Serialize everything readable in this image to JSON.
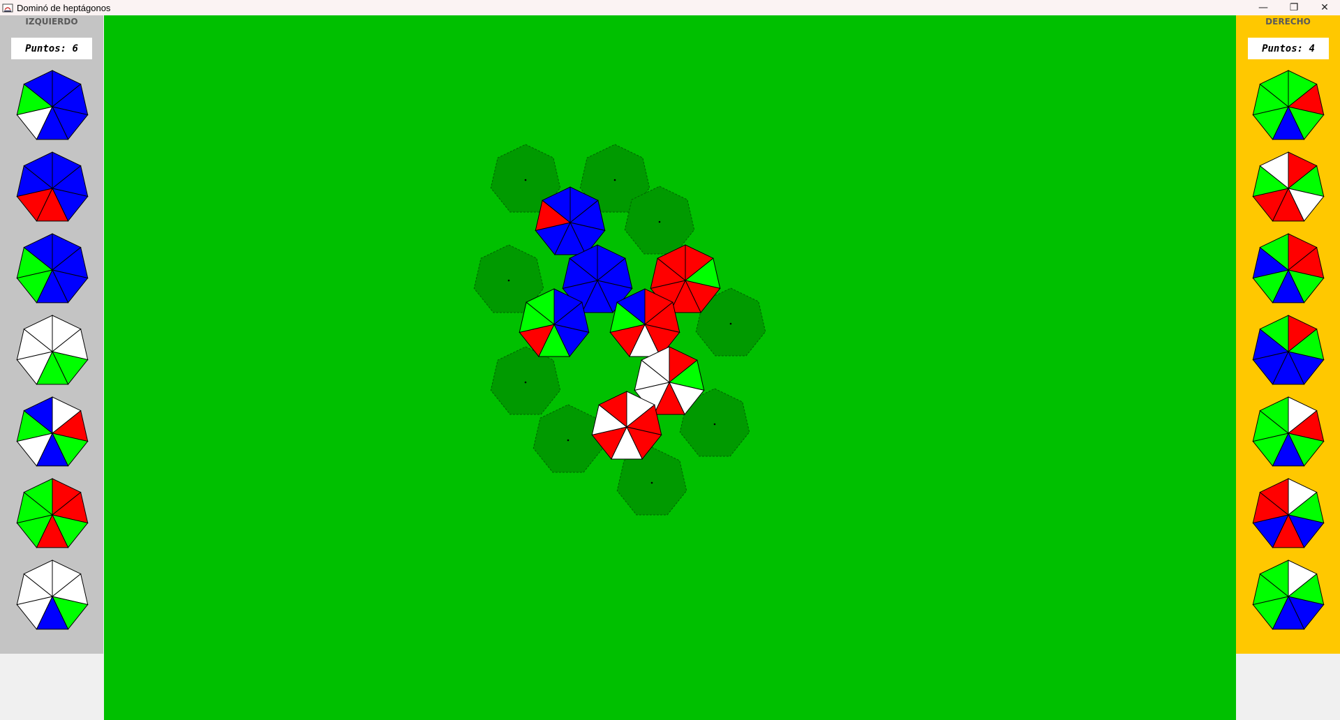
{
  "window": {
    "title": "Dominó de heptágonos",
    "icon": "java-cup-icon",
    "controls": [
      "minimize-icon",
      "restore-icon",
      "close-icon"
    ]
  },
  "colors": {
    "board": "#00c000",
    "slot": "#009a00",
    "left_panel": "#c4c4c4",
    "right_panel": "#ffc800",
    "B": "#0000ff",
    "R": "#ff0000",
    "G": "#00ff00",
    "W": "#ffffff"
  },
  "players": {
    "left": {
      "name": "IZQUIERDO",
      "score_label": "Puntos: 6",
      "pieces": [
        "BBBBWGB",
        "BBBRRBB",
        "BBBBGGB",
        "WWGGWWW",
        "WRGBWGB",
        "RRGRGGG",
        "WWGBWWW"
      ]
    },
    "right": {
      "name": "DERECHO",
      "score_label": "Puntos: 4",
      "pieces": [
        "GRGBGGG",
        "RGWRRGW",
        "RRGBGBG",
        "RGBBBBG",
        "WRGBGGG",
        "WGBRBRR",
        "WGBBGGG"
      ]
    }
  },
  "board": {
    "placed_pieces": [
      {
        "name": "board-piece-1",
        "colors": "BBBBBRB"
      },
      {
        "name": "board-piece-2",
        "colors": "BBBBBBB"
      },
      {
        "name": "board-piece-3",
        "colors": "BBBGRGG"
      },
      {
        "name": "board-piece-4",
        "colors": "RGRRRRR"
      },
      {
        "name": "board-piece-5",
        "colors": "RRRWRGB"
      },
      {
        "name": "board-piece-6",
        "colors": "RGWRWWW"
      },
      {
        "name": "board-piece-7",
        "colors": "WRRWRWR"
      }
    ],
    "empty_slot_count": 9
  }
}
